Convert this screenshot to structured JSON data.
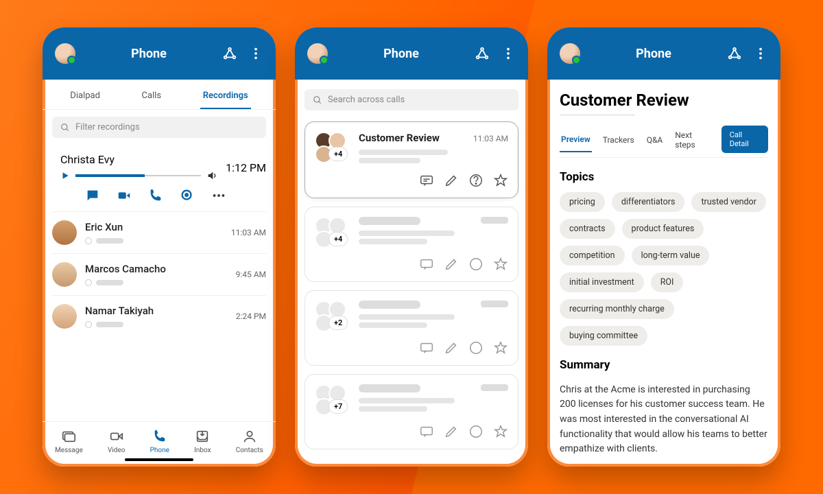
{
  "header": {
    "title": "Phone"
  },
  "screen1": {
    "tabs": [
      "Dialpad",
      "Calls",
      "Recordings"
    ],
    "active_tab": 2,
    "filter_placeholder": "Filter recordings",
    "recordings": [
      {
        "name": "Christa Evy",
        "time": "1:12 PM",
        "expanded": true
      },
      {
        "name": "Eric Xun",
        "time": "11:03 AM"
      },
      {
        "name": "Marcos Camacho",
        "time": "9:45 AM"
      },
      {
        "name": "Namar Takiyah",
        "time": "2:24 PM"
      }
    ],
    "bottom_nav": [
      {
        "label": "Message"
      },
      {
        "label": "Video"
      },
      {
        "label": "Phone",
        "active": true
      },
      {
        "label": "Inbox"
      },
      {
        "label": "Contacts"
      }
    ]
  },
  "screen2": {
    "search_placeholder": "Search across calls",
    "calls": [
      {
        "title": "Customer Review",
        "time": "11:03 AM",
        "overflow": "+4",
        "selected": true
      },
      {
        "overflow": "+4"
      },
      {
        "overflow": "+2"
      },
      {
        "overflow": "+7"
      }
    ]
  },
  "screen3": {
    "title": "Customer Review",
    "tabs": [
      "Preview",
      "Trackers",
      "Q&A",
      "Next steps"
    ],
    "active_tab": 0,
    "detail_button": "Call Detail",
    "topics_heading": "Topics",
    "topics": [
      "pricing",
      "differentiators",
      "trusted vendor",
      "contracts",
      "product features",
      "competition",
      "long-term value",
      "initial investment",
      "ROI",
      "recurring monthly charge",
      "buying committee"
    ],
    "summary_heading": "Summary",
    "summary_text": "Chris at the Acme is interested in purchasing 200 licenses for his customer success team. He was most interested in the conversational AI functionality that would allow his teams to better empathize with clients."
  }
}
